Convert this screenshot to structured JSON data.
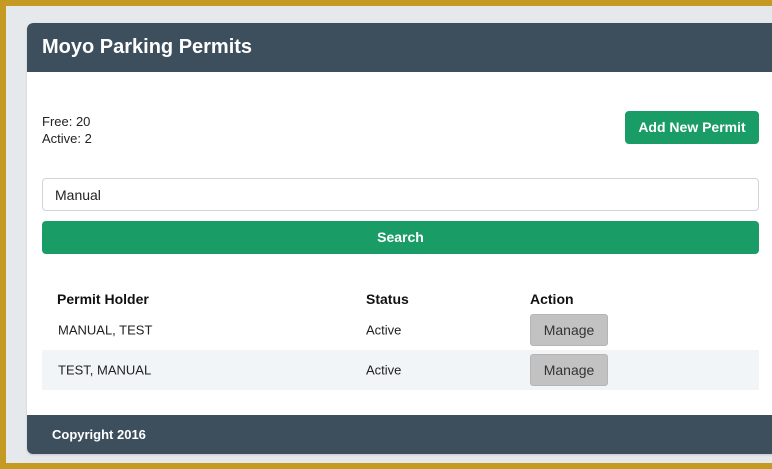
{
  "app": {
    "title": "Moyo Parking Permits"
  },
  "summary": {
    "free": "Free: 20",
    "active": "Active: 2"
  },
  "actions": {
    "add_label": "Add New Permit"
  },
  "search": {
    "value": "Manual",
    "button_label": "Search"
  },
  "table": {
    "headers": [
      "Permit Holder",
      "Status",
      "Action"
    ],
    "rows": [
      {
        "holder": "MANUAL, TEST",
        "status": "Active",
        "action": "Manage"
      },
      {
        "holder": "TEST, MANUAL",
        "status": "Active",
        "action": "Manage"
      }
    ]
  },
  "footer": {
    "copyright": "Copyright 2016"
  },
  "colors": {
    "header_bg": "#3d4f5d",
    "primary": "#1a9c66",
    "frame": "#c49a22",
    "manage_bg": "#c2c2c2"
  }
}
